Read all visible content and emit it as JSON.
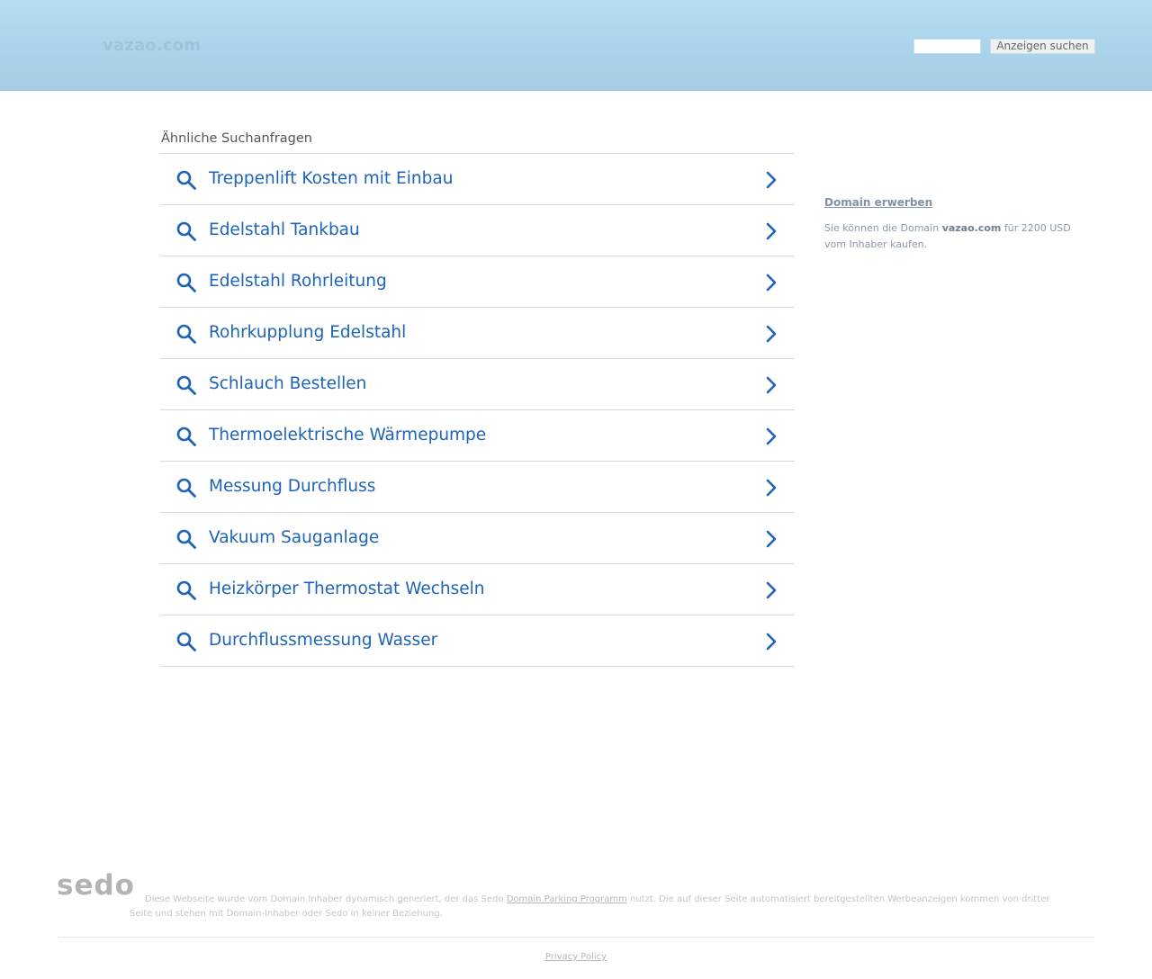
{
  "header": {
    "site_name": "vazao.com",
    "search_placeholder": "",
    "search_button": "Anzeigen suchen"
  },
  "related": {
    "title": "Ähnliche Suchanfragen",
    "items": [
      {
        "label": "Treppenlift Kosten mit Einbau"
      },
      {
        "label": "Edelstahl Tankbau"
      },
      {
        "label": "Edelstahl Rohrleitung"
      },
      {
        "label": "Rohrkupplung Edelstahl"
      },
      {
        "label": "Schlauch Bestellen"
      },
      {
        "label": "Thermoelektrische Wärmepumpe"
      },
      {
        "label": "Messung Durchfluss"
      },
      {
        "label": "Vakuum Sauganlage"
      },
      {
        "label": "Heizkörper Thermostat Wechseln"
      },
      {
        "label": "Durchflussmessung Wasser"
      }
    ]
  },
  "sidebar": {
    "title": "Domain erwerben",
    "text_before": "Sie können die Domain ",
    "domain": "vazao.com",
    "text_after": " für 2200 USD vom Inhaber kaufen."
  },
  "footer": {
    "brand": "sedo",
    "disclaimer_before": "Diese Webseite wurde vom Domain Inhaber dynamisch generiert, der das Sedo ",
    "disclaimer_link": "Domain Parking Programm",
    "disclaimer_after": " nutzt. Die auf dieser Seite automatisiert bereitgestellten Werbeanzeigen kommen von dritter Seite und stehen mit Domain-Inhaber oder Sedo in keiner Beziehung.",
    "privacy": "Privacy Policy"
  },
  "colors": {
    "link_blue": "#1d64b8",
    "header_blue": "#b5def4"
  },
  "icons": {
    "row_icon": "search-icon",
    "row_arrow": "chevron-right-icon"
  }
}
